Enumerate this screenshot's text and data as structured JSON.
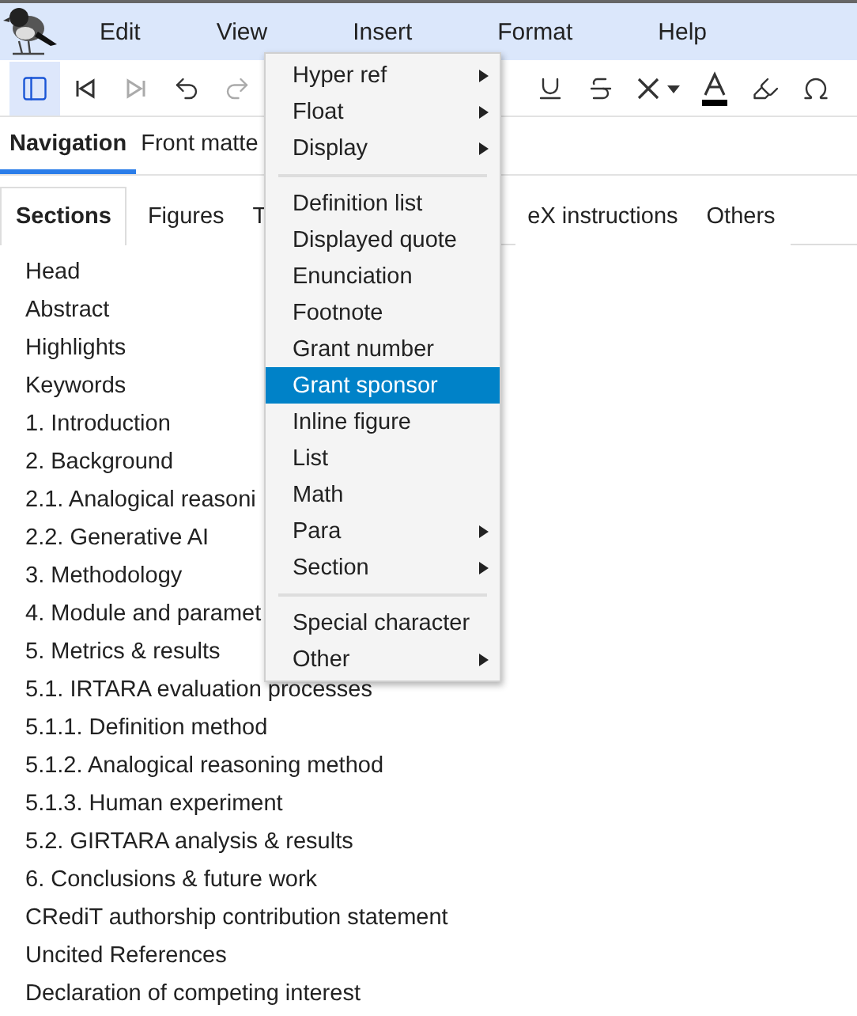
{
  "menubar": {
    "items": [
      {
        "label": "Edit"
      },
      {
        "label": "View"
      },
      {
        "label": "Insert"
      },
      {
        "label": "Format"
      },
      {
        "label": "Help"
      }
    ]
  },
  "toolbar": {
    "left": [
      {
        "kind": "sidebar",
        "selected": true,
        "disabled": false
      },
      {
        "kind": "first",
        "selected": false,
        "disabled": false
      },
      {
        "kind": "last",
        "selected": false,
        "disabled": true
      },
      {
        "kind": "undo",
        "selected": false,
        "disabled": false
      },
      {
        "kind": "redo",
        "selected": false,
        "disabled": true
      }
    ],
    "right": [
      {
        "kind": "underline",
        "selected": false,
        "disabled": false
      },
      {
        "kind": "strike",
        "selected": false,
        "disabled": false
      },
      {
        "kind": "clear",
        "selected": false,
        "disabled": false
      },
      {
        "kind": "color",
        "selected": false,
        "disabled": false
      },
      {
        "kind": "highlight",
        "selected": false,
        "disabled": false
      },
      {
        "kind": "omega",
        "selected": false,
        "disabled": false
      }
    ]
  },
  "panel_tabs": [
    {
      "label": "Navigation",
      "selected": true
    },
    {
      "label": "Front matte",
      "selected": false
    }
  ],
  "sub_tabs": [
    {
      "label": "Sections",
      "selected": true
    },
    {
      "label": "Figures",
      "selected": false
    },
    {
      "label": "T",
      "selected": false
    },
    {
      "label": "eX instructions",
      "selected": false
    },
    {
      "label": "Others",
      "selected": false
    }
  ],
  "sections": [
    "Head",
    "Abstract",
    "Highlights",
    "Keywords",
    "1. Introduction",
    "2. Background",
    "2.1. Analogical reasoni",
    "2.2. Generative AI",
    "3. Methodology",
    "4. Module and paramet",
    "5. Metrics & results",
    "5.1. IRTARA evaluation processes",
    "5.1.1. Definition method",
    "5.1.2. Analogical reasoning method",
    "5.1.3. Human experiment",
    "5.2. GIRTARA analysis & results",
    "6. Conclusions & future work",
    "CRediT authorship contribution statement",
    "Uncited References",
    "Declaration of competing interest"
  ],
  "insert_menu": [
    {
      "kind": "item",
      "label": "Hyper ref",
      "submenu": true,
      "selected": false
    },
    {
      "kind": "item",
      "label": "Float",
      "submenu": true,
      "selected": false
    },
    {
      "kind": "item",
      "label": "Display",
      "submenu": true,
      "selected": false
    },
    {
      "kind": "separator"
    },
    {
      "kind": "item",
      "label": "Definition list",
      "submenu": false,
      "selected": false
    },
    {
      "kind": "item",
      "label": "Displayed quote",
      "submenu": false,
      "selected": false
    },
    {
      "kind": "item",
      "label": "Enunciation",
      "submenu": false,
      "selected": false
    },
    {
      "kind": "item",
      "label": "Footnote",
      "submenu": false,
      "selected": false
    },
    {
      "kind": "item",
      "label": "Grant number",
      "submenu": false,
      "selected": false
    },
    {
      "kind": "item",
      "label": "Grant sponsor",
      "submenu": false,
      "selected": true
    },
    {
      "kind": "item",
      "label": "Inline figure",
      "submenu": false,
      "selected": false
    },
    {
      "kind": "item",
      "label": "List",
      "submenu": false,
      "selected": false
    },
    {
      "kind": "item",
      "label": "Math",
      "submenu": false,
      "selected": false
    },
    {
      "kind": "item",
      "label": "Para",
      "submenu": true,
      "selected": false
    },
    {
      "kind": "item",
      "label": "Section",
      "submenu": true,
      "selected": false
    },
    {
      "kind": "separator"
    },
    {
      "kind": "item",
      "label": "Special character",
      "submenu": false,
      "selected": false
    },
    {
      "kind": "item",
      "label": "Other",
      "submenu": true,
      "selected": false
    }
  ]
}
